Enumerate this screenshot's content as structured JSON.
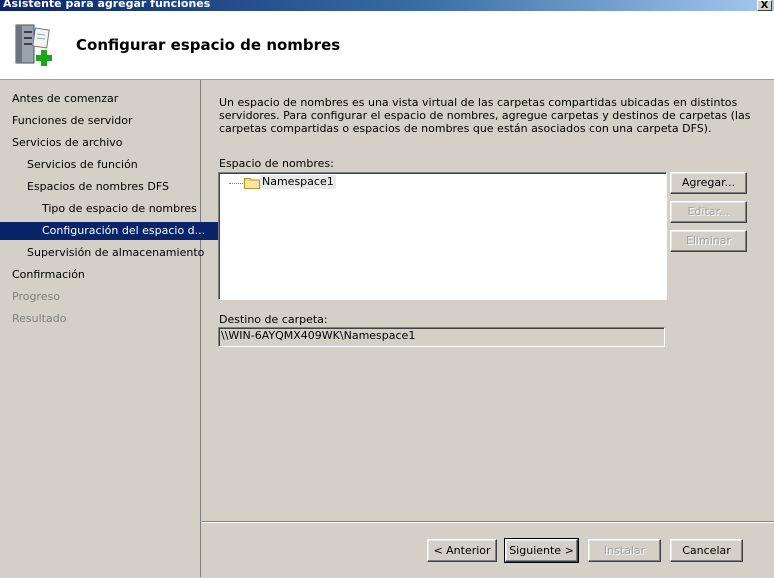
{
  "window": {
    "title": "Asistente para agregar funciones",
    "close_glyph": "X"
  },
  "header": {
    "title": "Configurar espacio de nombres",
    "icon": "server-add-icon"
  },
  "nav": {
    "items": [
      {
        "label": "Antes de comenzar",
        "state": "normal"
      },
      {
        "label": "Funciones de servidor",
        "state": "normal"
      },
      {
        "label": "Servicios de archivo",
        "state": "normal"
      },
      {
        "label": "Servicios de función",
        "state": "normal"
      },
      {
        "label": "Espacios de nombres DFS",
        "state": "normal"
      },
      {
        "label": "Tipo de espacio de nombres",
        "state": "normal"
      },
      {
        "label": "Configuración del espacio d...",
        "state": "selected"
      },
      {
        "label": "Supervisión de almacenamiento",
        "state": "normal"
      },
      {
        "label": "Confirmación",
        "state": "normal"
      },
      {
        "label": "Progreso",
        "state": "disabled"
      },
      {
        "label": "Resultado",
        "state": "disabled"
      }
    ]
  },
  "content": {
    "description": "Un espacio de nombres es una vista virtual de las carpetas compartidas ubicadas en distintos servidores. Para configurar el espacio de nombres, agregue carpetas y destinos de carpetas (las carpetas compartidas o espacios de nombres que están asociados con una carpeta DFS).",
    "namespace_label": "Espacio de nombres:",
    "tree": [
      {
        "label": "Namespace1",
        "icon": "folder-icon"
      }
    ],
    "buttons": {
      "add": "Agregar...",
      "edit": "Editar...",
      "remove": "Eliminar"
    },
    "target_label": "Destino de carpeta:",
    "target_value": "\\\\WIN-6AYQMX409WK\\Namespace1"
  },
  "footer": {
    "back": "< Anterior",
    "next": "Siguiente >",
    "install": "Instalar",
    "cancel": "Cancelar"
  },
  "colors": {
    "selection": "#0a246a",
    "dialog_bg": "#d4d0c8"
  }
}
